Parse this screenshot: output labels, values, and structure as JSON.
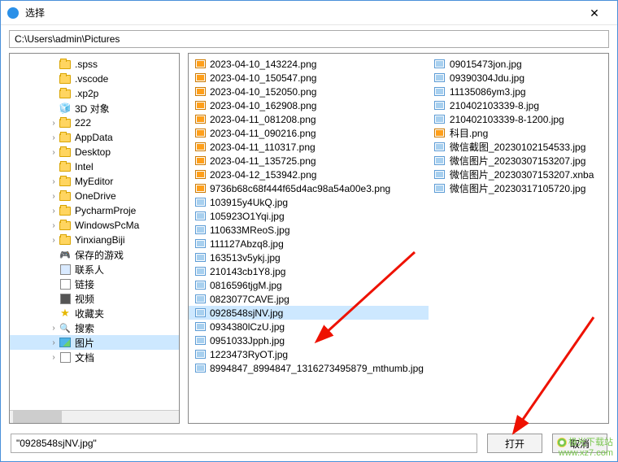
{
  "title": "选择",
  "path": "C:\\Users\\admin\\Pictures",
  "tree": [
    {
      "label": ".spss",
      "icon": "folder",
      "expandable": false
    },
    {
      "label": ".vscode",
      "icon": "folder",
      "expandable": false
    },
    {
      "label": ".xp2p",
      "icon": "folder",
      "expandable": false
    },
    {
      "label": "3D 对象",
      "icon": "3d",
      "expandable": false
    },
    {
      "label": "222",
      "icon": "folder",
      "expandable": true
    },
    {
      "label": "AppData",
      "icon": "folder",
      "expandable": true
    },
    {
      "label": "Desktop",
      "icon": "folder",
      "expandable": true
    },
    {
      "label": "Intel",
      "icon": "folder",
      "expandable": false
    },
    {
      "label": "MyEditor",
      "icon": "folder",
      "expandable": true
    },
    {
      "label": "OneDrive",
      "icon": "folder",
      "expandable": true
    },
    {
      "label": "PycharmProje",
      "icon": "folder",
      "expandable": true
    },
    {
      "label": "WindowsPcMa",
      "icon": "folder",
      "expandable": true
    },
    {
      "label": "YinxiangBiji",
      "icon": "folder",
      "expandable": true
    },
    {
      "label": "保存的游戏",
      "icon": "games",
      "expandable": false
    },
    {
      "label": "联系人",
      "icon": "contacts",
      "expandable": false
    },
    {
      "label": "链接",
      "icon": "links",
      "expandable": false
    },
    {
      "label": "视频",
      "icon": "video",
      "expandable": false
    },
    {
      "label": "收藏夹",
      "icon": "fav",
      "expandable": false
    },
    {
      "label": "搜索",
      "icon": "search",
      "expandable": true
    },
    {
      "label": "图片",
      "icon": "pictures",
      "expandable": true,
      "selected": true
    },
    {
      "label": "文档",
      "icon": "docs",
      "expandable": true
    }
  ],
  "files_col1": [
    {
      "name": "2023-04-10_143224.png",
      "t": "png"
    },
    {
      "name": "2023-04-10_150547.png",
      "t": "png"
    },
    {
      "name": "2023-04-10_152050.png",
      "t": "png"
    },
    {
      "name": "2023-04-10_162908.png",
      "t": "png"
    },
    {
      "name": "2023-04-11_081208.png",
      "t": "png"
    },
    {
      "name": "2023-04-11_090216.png",
      "t": "png"
    },
    {
      "name": "2023-04-11_110317.png",
      "t": "png"
    },
    {
      "name": "2023-04-11_135725.png",
      "t": "png"
    },
    {
      "name": "2023-04-12_153942.png",
      "t": "png"
    },
    {
      "name": "9736b68c68f444f65d4ac98a54a00e3.png",
      "t": "png"
    },
    {
      "name": "103915y4UkQ.jpg",
      "t": "jpg"
    },
    {
      "name": "105923O1Yqi.jpg",
      "t": "jpg"
    },
    {
      "name": "110633MReoS.jpg",
      "t": "jpg"
    },
    {
      "name": "111127Abzq8.jpg",
      "t": "jpg"
    },
    {
      "name": "163513v5ykj.jpg",
      "t": "jpg"
    },
    {
      "name": "210143cb1Y8.jpg",
      "t": "jpg"
    },
    {
      "name": "0816596tjgM.jpg",
      "t": "jpg"
    },
    {
      "name": "0823077CAVE.jpg",
      "t": "jpg"
    },
    {
      "name": "0928548sjNV.jpg",
      "t": "jpg",
      "selected": true
    },
    {
      "name": "0934380lCzU.jpg",
      "t": "jpg"
    },
    {
      "name": "0951033Jpph.jpg",
      "t": "jpg"
    },
    {
      "name": "1223473RyOT.jpg",
      "t": "jpg"
    },
    {
      "name": "8994847_8994847_1316273495879_mthumb.jpg",
      "t": "jpg"
    }
  ],
  "files_col2": [
    {
      "name": "09015473jon.jpg",
      "t": "jpg"
    },
    {
      "name": "09390304Jdu.jpg",
      "t": "jpg"
    },
    {
      "name": "11135086ym3.jpg",
      "t": "jpg"
    },
    {
      "name": "210402103339-8.jpg",
      "t": "jpg"
    },
    {
      "name": "210402103339-8-1200.jpg",
      "t": "jpg"
    },
    {
      "name": "科目.png",
      "t": "png"
    },
    {
      "name": "微信截图_20230102154533.jpg",
      "t": "jpg"
    },
    {
      "name": "微信图片_20230307153207.jpg",
      "t": "jpg"
    },
    {
      "name": "微信图片_20230307153207.xnba",
      "t": "jpg"
    },
    {
      "name": "微信图片_20230317105720.jpg",
      "t": "jpg"
    }
  ],
  "filename_value": "\"0928548sjNV.jpg\"",
  "buttons": {
    "open": "打开",
    "cancel": "取消"
  },
  "watermark": {
    "line1": "极光下载站",
    "line2": "www.xz7.com"
  }
}
